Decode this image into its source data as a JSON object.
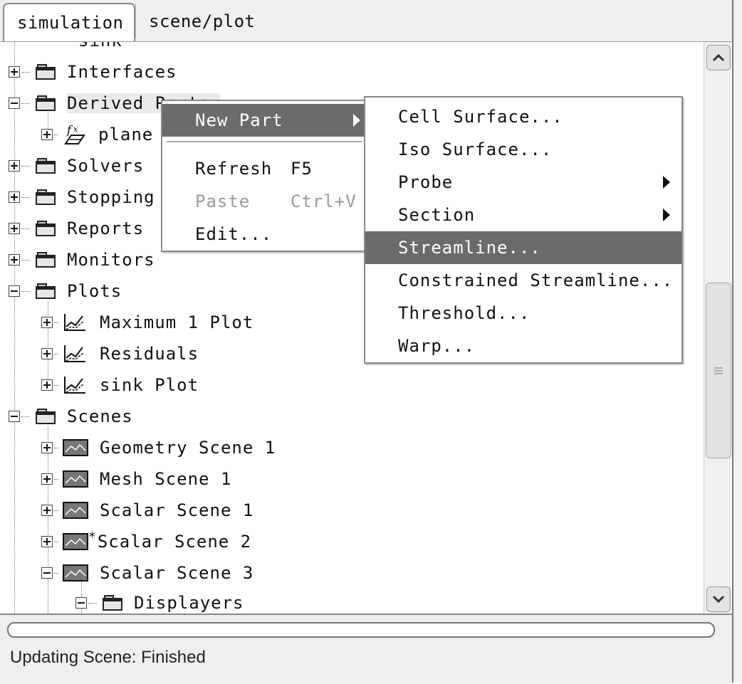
{
  "tabs": [
    {
      "label": "simulation",
      "active": true
    },
    {
      "label": "scene/plot",
      "active": false
    }
  ],
  "tree": {
    "partial_top_label": "sink",
    "nodes": [
      {
        "label": "Interfaces",
        "icon": "folder-icon",
        "expander": "plus"
      },
      {
        "label": "Derived Parts",
        "icon": "folder-icon",
        "expander": "minus"
      },
      {
        "label": "plane",
        "icon": "fx-icon",
        "expander": "plus"
      },
      {
        "label": "Solvers",
        "icon": "folder-icon",
        "expander": "plus"
      },
      {
        "label": "Stopping",
        "icon": "folder-icon",
        "expander": "plus"
      },
      {
        "label": "Reports",
        "icon": "folder-icon",
        "expander": "plus"
      },
      {
        "label": "Monitors",
        "icon": "folder-icon",
        "expander": "plus"
      },
      {
        "label": "Plots",
        "icon": "folder-icon",
        "expander": "minus"
      },
      {
        "label": "Maximum 1 Plot",
        "icon": "plot-icon",
        "expander": "plus"
      },
      {
        "label": "Residuals",
        "icon": "plot-icon",
        "expander": "plus"
      },
      {
        "label": "sink Plot",
        "icon": "plot-icon",
        "expander": "plus"
      },
      {
        "label": "Scenes",
        "icon": "folder-icon",
        "expander": "minus"
      },
      {
        "label": "Geometry Scene 1",
        "icon": "scene-icon",
        "expander": "plus"
      },
      {
        "label": "Mesh Scene 1",
        "icon": "scene-icon",
        "expander": "plus"
      },
      {
        "label": "Scalar Scene 1",
        "icon": "scene-icon",
        "expander": "plus"
      },
      {
        "label": "Scalar Scene 2",
        "icon": "scene-icon",
        "expander": "plus",
        "modified_mark": "*"
      },
      {
        "label": "Scalar Scene 3",
        "icon": "scene-icon",
        "expander": "minus"
      },
      {
        "label": "Displayers",
        "icon": "folder-icon",
        "expander": "minus"
      }
    ]
  },
  "context_menu": {
    "new_part": "New Part",
    "refresh": "Refresh",
    "refresh_shortcut": "F5",
    "paste": "Paste",
    "paste_shortcut": "Ctrl+V",
    "edit": "Edit..."
  },
  "submenu": {
    "cell_surface": "Cell Surface...",
    "iso_surface": "Iso Surface...",
    "probe": "Probe",
    "section": "Section",
    "streamline": "Streamline...",
    "constrained_streamline": "Constrained Streamline...",
    "threshold": "Threshold...",
    "warp": "Warp..."
  },
  "status": {
    "text": "Updating Scene: Finished",
    "progress": 0
  }
}
